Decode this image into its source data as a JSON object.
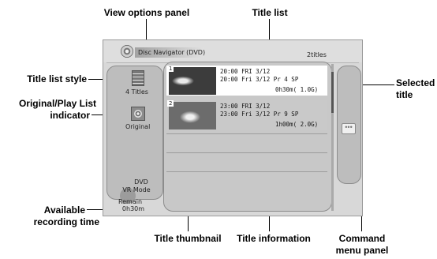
{
  "callouts": {
    "view_options_panel": "View options panel",
    "title_list": "Title list",
    "title_list_style": "Title list style",
    "original_play_list_1": "Original/Play List",
    "original_play_list_2": "indicator",
    "selected_title_1": "Selected",
    "selected_title_2": "title",
    "available_1": "Available",
    "available_2": "recording time",
    "title_thumbnail": "Title thumbnail",
    "title_information": "Title information",
    "command_1": "Command",
    "command_2": "menu panel"
  },
  "screen": {
    "nav_title": "Disc Navigator (DVD)",
    "title_count": "2titles",
    "view_panel": {
      "style_label": "4 Titles",
      "list_label": "Original"
    },
    "mode": {
      "line1": "DVD",
      "line2": "VR Mode"
    },
    "remain": {
      "label": "Remain",
      "value": "0h30m"
    },
    "titles": [
      {
        "number": "1",
        "line1": "20:00  FRI 3/12",
        "line2": "20:00   Fri 3/12  Pr 4   SP",
        "duration": "0h30m( 1.0G)",
        "selected": true
      },
      {
        "number": "2",
        "line1": "23:00  FRI 3/12",
        "line2": "23:00   Fri 3/12  Pr 9   SP",
        "duration": "1h00m( 2.0G)",
        "selected": false
      }
    ],
    "command_icon": "•••"
  }
}
